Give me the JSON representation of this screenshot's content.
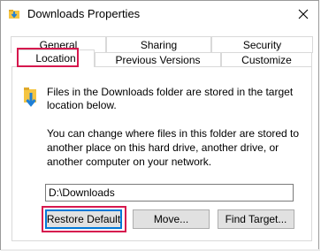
{
  "window": {
    "title": "Downloads Properties"
  },
  "tabs": [
    {
      "label": "General",
      "selected": false
    },
    {
      "label": "Sharing",
      "selected": false
    },
    {
      "label": "Security",
      "selected": false
    },
    {
      "label": "Location",
      "selected": true
    },
    {
      "label": "Previous Versions",
      "selected": false
    },
    {
      "label": "Customize",
      "selected": false
    }
  ],
  "location": {
    "description": "Files in the Downloads folder are stored in the target location below.",
    "info": "You can change where files in this folder are stored to another place on this hard drive, another drive, or another computer on your network.",
    "path": "D:\\Downloads"
  },
  "buttons": {
    "restore_default": "Restore Default",
    "move": "Move...",
    "find_target": "Find Target..."
  },
  "colors": {
    "highlight": "#d6184e",
    "folder": "#f5c542",
    "arrow": "#1e7fd6"
  },
  "icons": {
    "title_icon": "downloads-folder-icon",
    "close": "close-icon",
    "folder": "downloads-folder-icon"
  }
}
